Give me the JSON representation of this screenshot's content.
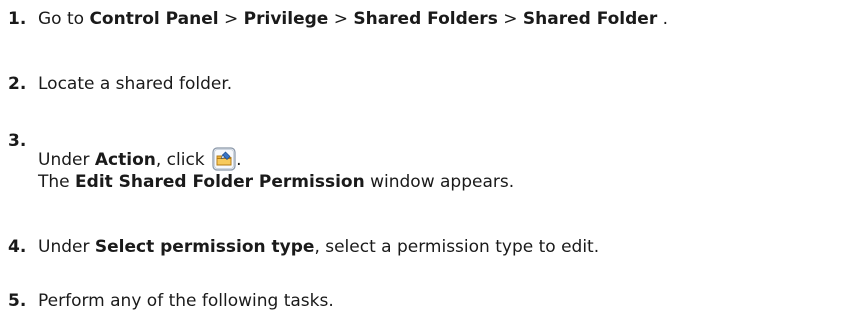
{
  "steps": [
    {
      "number": "1.",
      "go_to": "Go to",
      "path": [
        "Control Panel",
        "Privilege",
        "Shared Folders",
        "Shared Folder"
      ],
      "separator": ">",
      "end": "."
    },
    {
      "number": "2.",
      "text": "Locate a shared folder."
    },
    {
      "number": "3.",
      "under": "Under",
      "field": "Action",
      "click_text": ", click",
      "icon": "edit-folder-permission-icon",
      "end": ".",
      "result_prefix": "The",
      "result_window": "Edit Shared Folder Permission",
      "result_suffix": "window appears."
    },
    {
      "number": "4.",
      "under": "Under",
      "field": "Select permission type",
      "rest": ", select a permission type to edit."
    },
    {
      "number": "5.",
      "text": "Perform any of the following tasks."
    }
  ]
}
